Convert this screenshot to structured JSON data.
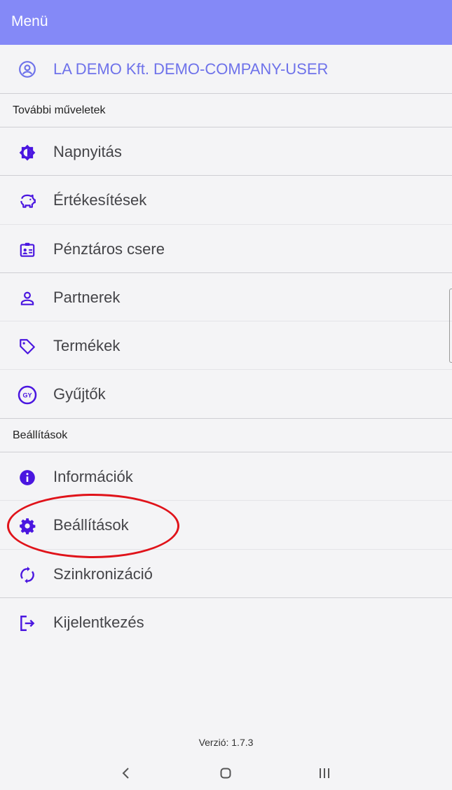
{
  "header": {
    "title": "Menü"
  },
  "user": {
    "label": "LA DEMO Kft. DEMO-COMPANY-USER",
    "icon": "account-circle-icon"
  },
  "sections": {
    "more_actions": "További műveletek",
    "settings": "Beállítások"
  },
  "items": [
    {
      "label": "Napnyitás",
      "icon": "brightness-icon"
    },
    {
      "label": "Értékesítések",
      "icon": "piggy-bank-icon"
    },
    {
      "label": "Pénztáros csere",
      "icon": "id-badge-icon"
    },
    {
      "label": "Partnerek",
      "icon": "person-icon"
    },
    {
      "label": "Termékek",
      "icon": "tag-icon"
    },
    {
      "label": "Gyűjtők",
      "icon": "gy-badge-icon",
      "badge_text": "GY"
    },
    {
      "label": "Információk",
      "icon": "info-icon"
    },
    {
      "label": "Beállítások",
      "icon": "gear-icon"
    },
    {
      "label": "Szinkronizáció",
      "icon": "sync-icon"
    },
    {
      "label": "Kijelentkezés",
      "icon": "logout-icon"
    }
  ],
  "version": "Verzió: 1.7.3",
  "colors": {
    "header": "#8489f7",
    "accent": "#4a16e0",
    "highlight": "#e0131a"
  }
}
